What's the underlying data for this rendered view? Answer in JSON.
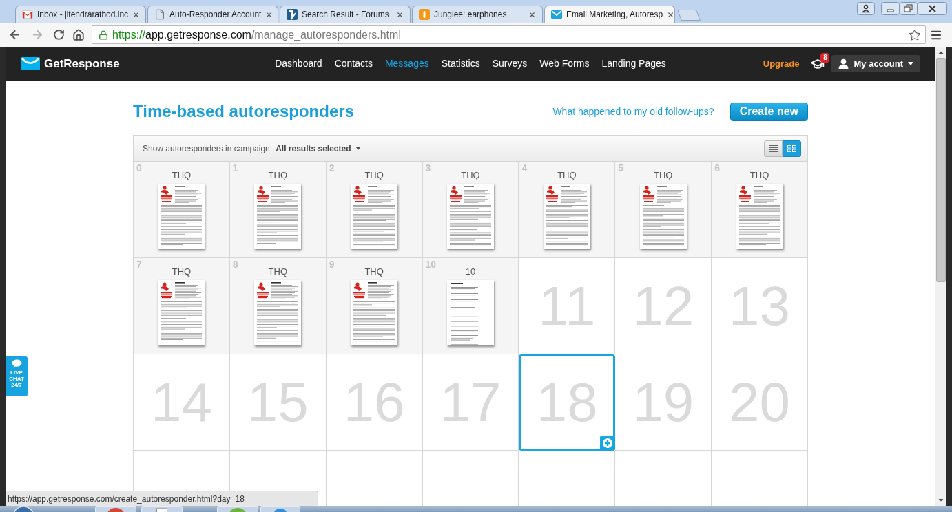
{
  "browser": {
    "tabs": [
      {
        "kind": "gmail",
        "title": "Inbox - jitendrarathod.inc",
        "selected": false
      },
      {
        "kind": "page",
        "title": "Auto-Responder Account",
        "selected": false
      },
      {
        "kind": "forum",
        "title": "Search Result - Forums",
        "selected": false
      },
      {
        "kind": "shop",
        "title": "Junglee: earphones",
        "selected": false
      },
      {
        "kind": "mail",
        "title": "Email Marketing, Autoresp",
        "selected": true
      }
    ],
    "address": {
      "scheme": "https://",
      "host": "app.getresponse.com",
      "path": "/manage_autoresponders.html"
    }
  },
  "navbar": {
    "brand": "GetResponse",
    "items": [
      {
        "label": "Dashboard",
        "selected": false
      },
      {
        "label": "Contacts",
        "selected": false
      },
      {
        "label": "Messages",
        "selected": true
      },
      {
        "label": "Statistics",
        "selected": false
      },
      {
        "label": "Surveys",
        "selected": false
      },
      {
        "label": "Web Forms",
        "selected": false
      },
      {
        "label": "Landing Pages",
        "selected": false
      }
    ],
    "upgrade": "Upgrade",
    "badge": "8",
    "account": "My account"
  },
  "header": {
    "title": "Time-based autoresponders",
    "help_link": "What happened to my old follow-ups?",
    "create_button": "Create new"
  },
  "filter": {
    "label": "Show autoresponders in campaign:",
    "value": "All results selected",
    "views": [
      {
        "kind": "list",
        "selected": false
      },
      {
        "kind": "grid",
        "selected": true
      }
    ]
  },
  "calendar": {
    "days": [
      {
        "day": "0",
        "kind": "branded",
        "title": "THQ",
        "selected": false
      },
      {
        "day": "1",
        "kind": "branded",
        "title": "THQ",
        "selected": false
      },
      {
        "day": "2",
        "kind": "branded",
        "title": "THQ",
        "selected": false
      },
      {
        "day": "3",
        "kind": "branded",
        "title": "THQ",
        "selected": false
      },
      {
        "day": "4",
        "kind": "branded",
        "title": "THQ",
        "selected": false
      },
      {
        "day": "5",
        "kind": "branded",
        "title": "THQ",
        "selected": false
      },
      {
        "day": "6",
        "kind": "branded",
        "title": "THQ",
        "selected": false
      },
      {
        "day": "7",
        "kind": "branded",
        "title": "THQ",
        "selected": false
      },
      {
        "day": "8",
        "kind": "branded",
        "title": "THQ",
        "selected": false
      },
      {
        "day": "9",
        "kind": "branded",
        "title": "THQ",
        "selected": false
      },
      {
        "day": "10",
        "kind": "plain",
        "title": "10",
        "selected": false
      },
      {
        "day": "11",
        "kind": "empty",
        "selected": false
      },
      {
        "day": "12",
        "kind": "empty",
        "selected": false
      },
      {
        "day": "13",
        "kind": "empty",
        "selected": false
      },
      {
        "day": "14",
        "kind": "empty",
        "selected": false
      },
      {
        "day": "15",
        "kind": "empty",
        "selected": false
      },
      {
        "day": "16",
        "kind": "empty",
        "selected": false
      },
      {
        "day": "17",
        "kind": "empty",
        "selected": false
      },
      {
        "day": "18",
        "kind": "empty",
        "selected": true
      },
      {
        "day": "19",
        "kind": "empty",
        "selected": false
      },
      {
        "day": "20",
        "kind": "empty",
        "selected": false
      }
    ]
  },
  "live_chat": "LIVE CHAT 24/7",
  "status_bar": "https://app.getresponse.com/create_autoresponder.html?day=18"
}
